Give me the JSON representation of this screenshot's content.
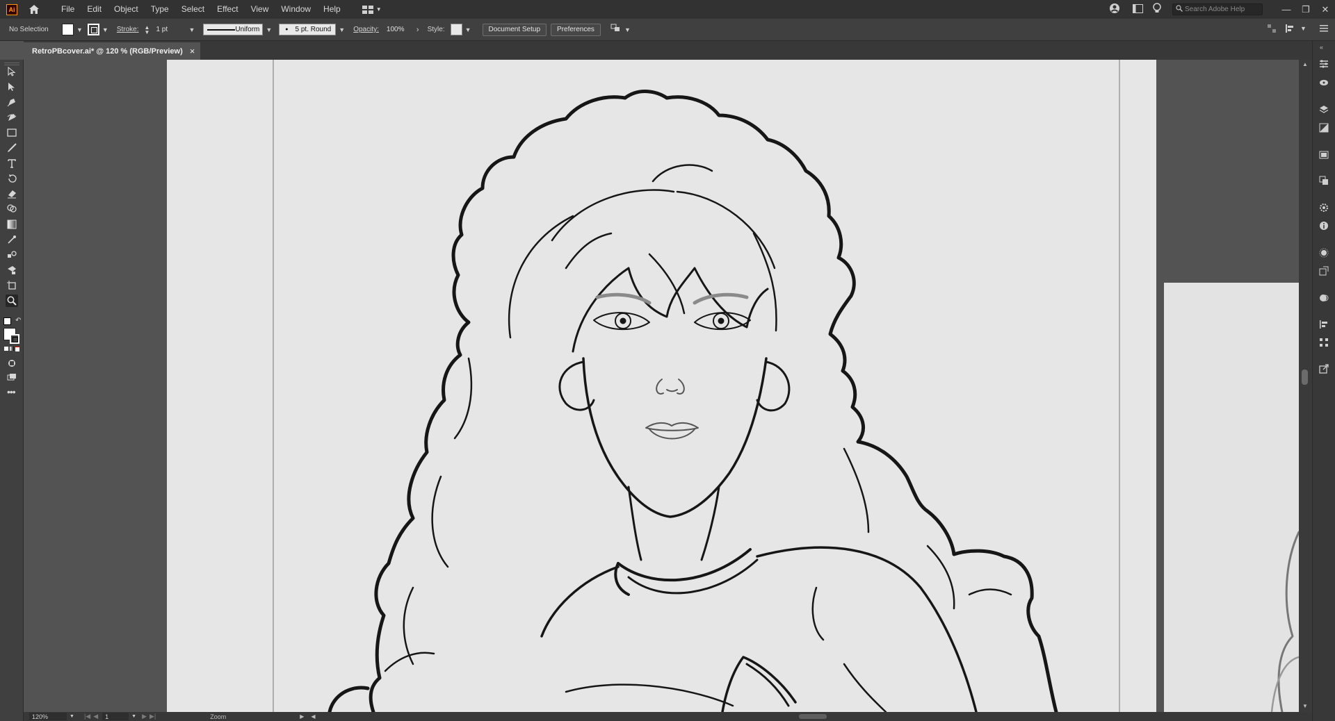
{
  "app": {
    "logo": "Ai",
    "menu": [
      "File",
      "Edit",
      "Object",
      "Type",
      "Select",
      "Effect",
      "View",
      "Window",
      "Help"
    ],
    "search_placeholder": "Search Adobe Help"
  },
  "control_bar": {
    "selection": "No Selection",
    "stroke_label": "Stroke:",
    "stroke_weight": "1 pt",
    "profile": "Uniform",
    "brush": "5 pt. Round",
    "opacity_label": "Opacity:",
    "opacity_value": "100%",
    "style_label": "Style:",
    "document_setup": "Document Setup",
    "preferences": "Preferences"
  },
  "document_tab": {
    "title": "RetroPBcover.ai* @ 120 % (RGB/Preview)",
    "close": "×"
  },
  "status_bar": {
    "zoom": "120%",
    "artboard": "1",
    "tool": "Zoom"
  },
  "colors": {
    "accent": "#ff9a00",
    "artboard": "#e6e6e6",
    "ink": "#141414",
    "ui_dark": "#323232"
  },
  "tools": [
    "selection-tool",
    "direct-selection-tool",
    "pen-tool",
    "curvature-tool",
    "rectangle-tool",
    "paintbrush-tool",
    "type-tool",
    "rotate-tool",
    "eraser-tool",
    "shape-builder-tool",
    "gradient-tool",
    "eyedropper-tool",
    "blend-tool",
    "live-paint-tool",
    "artboard-tool",
    "zoom-tool"
  ]
}
